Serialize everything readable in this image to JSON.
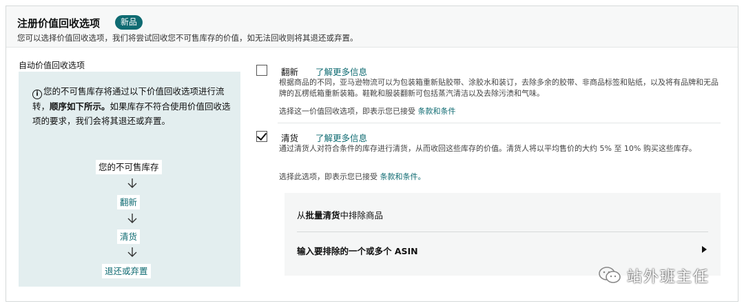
{
  "header": {
    "title": "注册价值回收选项",
    "badge": "新品",
    "subtitle": "您可以选择价值回收选项，我们将尝试回收您不可售库存的价值，如无法回收则将其退还或弃置。"
  },
  "left": {
    "label": "自动价值回收选项",
    "info_part1": "您的不可售库存将通过以下价值回收选项进行流转，",
    "info_bold": "顺序如下所示。",
    "info_part2": "如果库存不符合使用价值回收选项的要求，我们会将其退还或弃置。",
    "flow": [
      "您的不可售库存",
      "翻新",
      "清货",
      "退还或弃置"
    ]
  },
  "options": [
    {
      "title": "翻新",
      "link": "了解更多信息",
      "checked": false,
      "description": "根据商品的不同，亚马逊物流可以为包装箱重新贴胶带、涂胶水和装订，去除多余的胶带、非商品标签和贴纸，以及将有品牌和无品牌的瓦楞纸箱重新装箱。鞋靴和服装翻新可包括蒸汽清洁以及去除污渍和气味。",
      "terms_text": "选择这一价值回收选项，即表示您已接受",
      "terms_link": "条款和条件"
    },
    {
      "title": "清货",
      "link": "了解更多信息",
      "checked": true,
      "description": "通过清货人对符合条件的库存进行清货，从而收回这些库存的价值。清货人将以平均售价的大约 5% 至 10% 购买这些库存。",
      "terms_text": "选择此选项，即表示您已接受",
      "terms_link": "条款和条件。"
    }
  ],
  "exclude": {
    "prefix": "从",
    "bold": "批量清货",
    "suffix": "中排除商品",
    "asin_label": "输入要排除的一个或多个 ASIN"
  },
  "watermark": {
    "text": "站外班主任"
  },
  "colors": {
    "accent": "#0f6b72",
    "panel_bg": "#e3eeef"
  }
}
